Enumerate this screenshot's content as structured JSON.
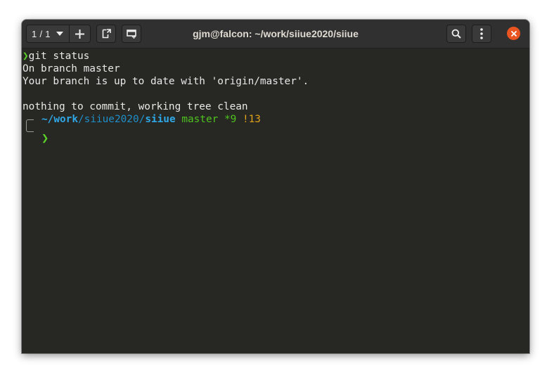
{
  "window": {
    "title": "gjm@falcon: ~/work/siiue2020/siiue"
  },
  "toolbar": {
    "tab_counter": "1 / 1",
    "new_tab_icon": "plus-icon",
    "detach_icon": "detach-tab-icon",
    "new_window_icon": "new-window-icon",
    "search_icon": "search-icon",
    "menu_icon": "kebab-menu-icon",
    "close_icon": "close-icon"
  },
  "terminal": {
    "prompt_symbol": "❯",
    "command": "git status",
    "output": [
      "On branch master",
      "Your branch is up to date with 'origin/master'.",
      "",
      "nothing to commit, working tree clean"
    ],
    "prompt": {
      "path_tilde": "~/",
      "path_work": "work",
      "path_sep1": "/",
      "path_mid": "siiue2020",
      "path_sep2": "/",
      "path_cwd": "siiue",
      "branch": "master",
      "stash": "*9",
      "modified": "!13",
      "arrow": "❯"
    }
  },
  "colors": {
    "terminal_bg": "#272723",
    "titlebar_bg": "#303030",
    "prompt_arrow": "#5bd32a",
    "path_blue": "#2ea8e6",
    "branch_green": "#4fc31f",
    "modified_orange": "#e0a21a",
    "close_orange": "#e95420"
  }
}
